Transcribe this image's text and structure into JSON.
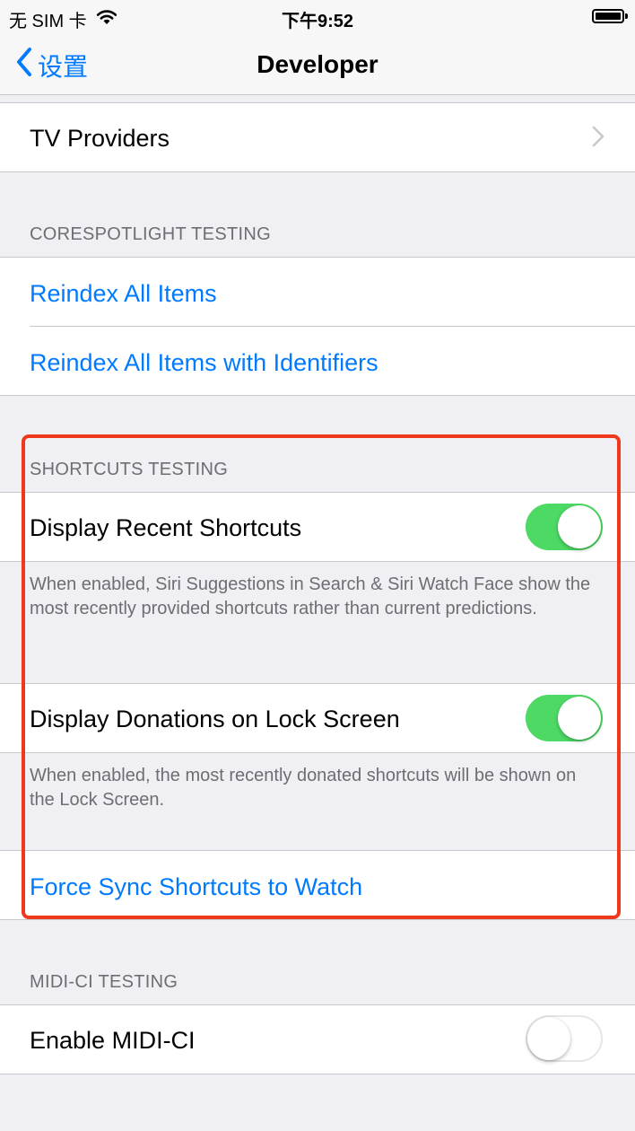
{
  "status_bar": {
    "carrier": "无 SIM 卡",
    "time": "下午9:52"
  },
  "nav": {
    "back_label": "设置",
    "title": "Developer"
  },
  "tv_providers": {
    "label": "TV Providers"
  },
  "corespotlight": {
    "header": "CORESPOTLIGHT TESTING",
    "reindex_all": "Reindex All Items",
    "reindex_identifiers": "Reindex All Items with Identifiers"
  },
  "shortcuts": {
    "header": "SHORTCUTS TESTING",
    "recent_label": "Display Recent Shortcuts",
    "recent_on": true,
    "recent_footer": "When enabled, Siri Suggestions in Search & Siri Watch Face show the most recently provided shortcuts rather than current predictions.",
    "donations_label": "Display Donations on Lock Screen",
    "donations_on": true,
    "donations_footer": "When enabled, the most recently donated shortcuts will be shown on the Lock Screen.",
    "force_sync": "Force Sync Shortcuts to Watch"
  },
  "midi": {
    "header": "MIDI-CI TESTING",
    "enable_label": "Enable MIDI-CI",
    "enable_on": false
  },
  "colors": {
    "accent": "#007aff",
    "toggle_on": "#4cd964",
    "highlight": "#f0391c",
    "background": "#efeff4"
  },
  "icons": {
    "wifi": "wifi-icon",
    "battery": "battery-icon",
    "back": "chevron-left-icon",
    "disclosure": "chevron-right-icon"
  }
}
